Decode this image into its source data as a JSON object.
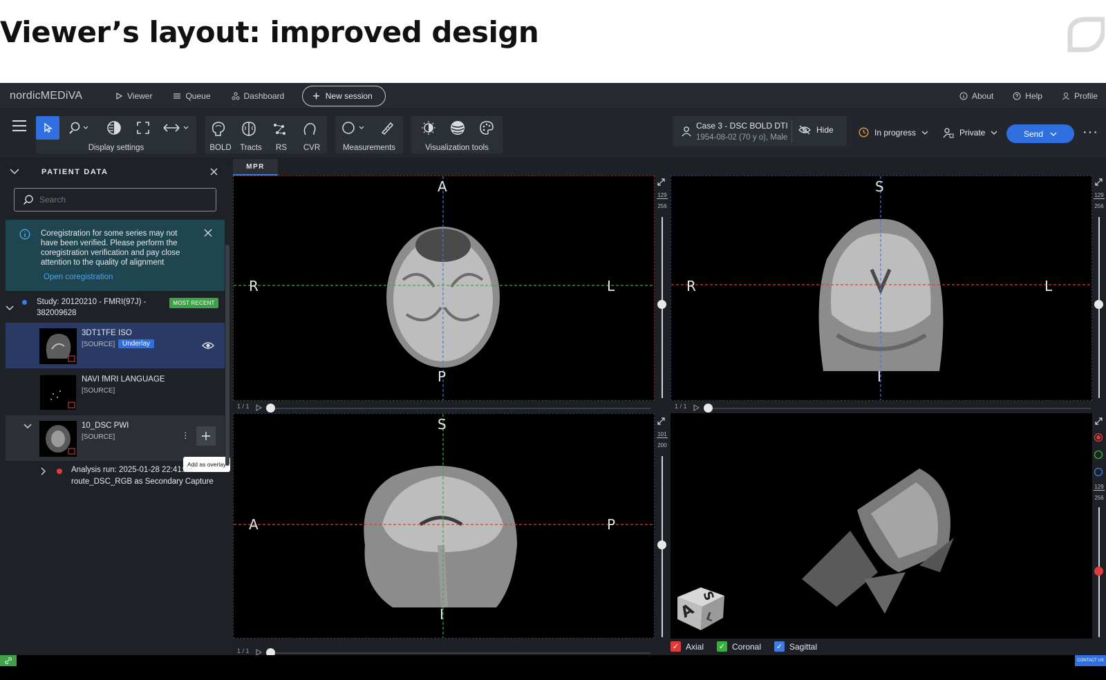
{
  "slide": {
    "title": "Viewer’s layout: improved design"
  },
  "nav": {
    "brand": "nordicMEDiVA",
    "viewer": "Viewer",
    "queue": "Queue",
    "dashboard": "Dashboard",
    "new_session": "New session",
    "about": "About",
    "help": "Help",
    "profile": "Profile"
  },
  "toolbar": {
    "display_settings": "Display settings",
    "bold": "BOLD",
    "tracts": "Tracts",
    "rs": "RS",
    "cvr": "CVR",
    "measurements": "Measurements",
    "visualization_tools": "Visualization tools"
  },
  "case": {
    "title": "Case 3 - DSC BOLD DTI",
    "subtitle": "1954-08-02 (70 y o), Male",
    "hide": "Hide",
    "status": "In progress",
    "privacy": "Private",
    "send": "Send"
  },
  "panel": {
    "title": "PATIENT DATA",
    "search_placeholder": "Search",
    "notice_text": "Coregistration for some series may not have been verified. Please perform the coregistration verification and pay close attention to the quality of alignment",
    "notice_link": "Open coregistration",
    "study_title": "Study: 20120210 - FMRI(97J) - 382009628",
    "study_badge": "MOST RECENT",
    "series": [
      {
        "name": "3DT1TFE ISO",
        "tag": "[SOURCE]",
        "badge": "Underlay"
      },
      {
        "name": "NAVI fMRI LANGUAGE",
        "tag": "[SOURCE]"
      },
      {
        "name": "10_DSC PWI",
        "tag": "[SOURCE]"
      }
    ],
    "tooltip": "Add as overlay",
    "analysis_line1": "Analysis run: 2025-01-28 22:41:48",
    "analysis_line2": "route_DSC_RGB as Secondary Capture"
  },
  "tabs": {
    "mpr": "MPR"
  },
  "viewports": {
    "axial": {
      "top": "A",
      "bottom": "P",
      "left": "R",
      "right": "L",
      "frame": "1 / 1",
      "level_top": "129",
      "level_bottom": "256"
    },
    "coronal": {
      "top": "S",
      "bottom": "I",
      "left": "R",
      "right": "L",
      "frame": "1 / 1",
      "level_top": "129",
      "level_bottom": "256"
    },
    "sagittal": {
      "top": "S",
      "bottom": "I",
      "left": "A",
      "right": "P",
      "frame": "1 / 1",
      "level_top": "101",
      "level_bottom": "200"
    },
    "volume": {
      "level_top": "129",
      "level_bottom": "256",
      "cube_s": "S",
      "cube_a": "A",
      "cube_l": "L"
    }
  },
  "planes": {
    "axial": "Axial",
    "coronal": "Coronal",
    "sagittal": "Sagittal"
  },
  "footer": {
    "contact": "CONTACT US"
  },
  "colors": {
    "accent": "#2f6fe0",
    "badge_green": "#3fa14a",
    "crosshair_red": "#e03b3b",
    "crosshair_green": "#36b23a",
    "crosshair_blue": "#3f7be0",
    "notice_bg": "#1f4650"
  }
}
